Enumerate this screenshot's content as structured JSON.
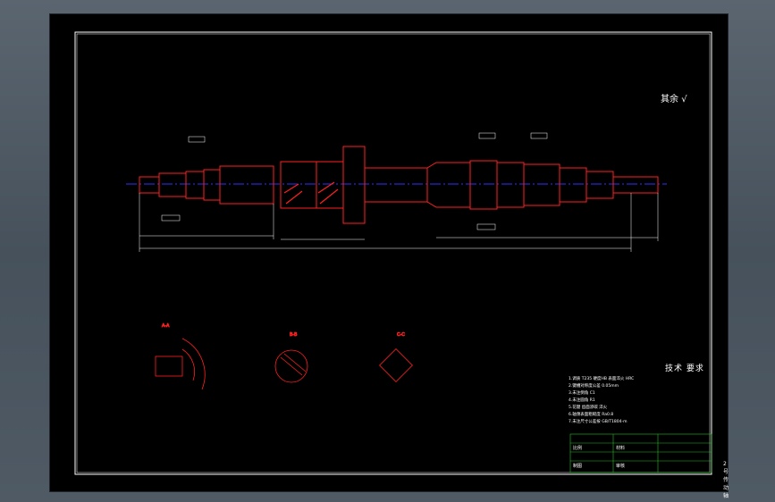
{
  "drawing": {
    "roughness_note": "其余 ",
    "roughness_symbol": "√",
    "technical_requirements": {
      "title": "技术 要求",
      "lines": [
        "1.调质 T235 硬度HB 表面淬火 HRC",
        "2.键槽对称度公差 0.05mm",
        "3.未注倒角 C1",
        "4.未注圆角 R1",
        "5.花键 齿面渗碳 淬火",
        "6.轴颈表面粗糙度 Ra0.8",
        "7.未注尺寸公差按 GB/T1804-m"
      ]
    },
    "title_block": {
      "part_name": "2号传动轴",
      "scale_label": "比例",
      "material_label": "材料",
      "drawn_label": "制图",
      "check_label": "审核"
    },
    "section_labels": [
      "A-A",
      "B-B",
      "C-C"
    ],
    "colors": {
      "background": "#000000",
      "outline": "#ff2020",
      "centerline": "#3030ff",
      "dimension": "#ffffff",
      "hatch": "#ff2020",
      "frame": "#ffffff",
      "title_grid": "#20c020"
    }
  }
}
